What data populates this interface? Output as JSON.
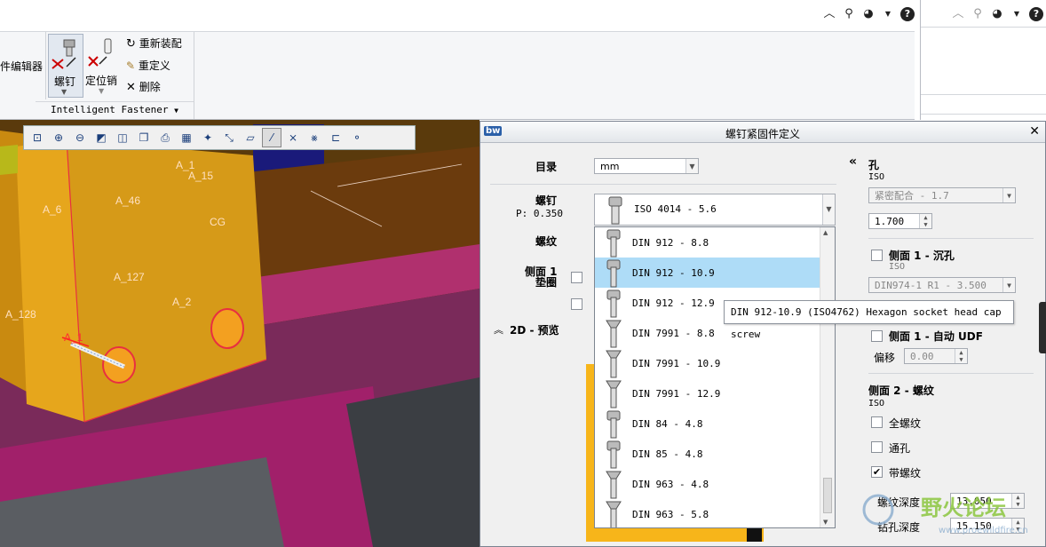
{
  "ribbon": {
    "partial_label": "件编辑器",
    "screw_label": "螺钉",
    "pin_label": "定位销",
    "reassemble_label": "重新装配",
    "redefine_label": "重定义",
    "delete_label": "删除",
    "group_label": "Intelligent Fastener"
  },
  "viewport": {
    "labels": [
      "A_6",
      "A_46",
      "A_127",
      "A_128",
      "A_2",
      "A_1",
      "CG",
      "A_1",
      "A_15"
    ]
  },
  "dialog": {
    "icon_text": "bw",
    "title": "螺钉紧固件定义",
    "catalog_label": "目录",
    "catalog_value": "mm",
    "screw_label": "螺钉",
    "screw_p": "P: 0.350",
    "screw_value": "ISO 4014 - 5.6",
    "thread_label": "螺纹",
    "side1_washer_label": "侧面 1",
    "side1_washer_label2": "垫圈",
    "preview_label": "2D - 预览",
    "collapse_glyph": "«",
    "hole_label": "孔",
    "hole_std": "ISO",
    "hole_fit": "紧密配合 - 1.7",
    "hole_size": "1.700",
    "side1_counter_label": "侧面 1 - 沉孔",
    "side1_counter_std": "ISO",
    "side1_counter_value": "DIN974-1 R1 - 3.500",
    "side1_udf_label": "侧面 1 - 自动 UDF",
    "offset_label": "偏移",
    "offset_value": "0.00",
    "side2_label": "侧面 2 - 螺纹",
    "side2_std": "ISO",
    "full_thread_label": "全螺纹",
    "through_label": "通孔",
    "threaded_label": "带螺纹",
    "thread_depth_label": "螺纹深度",
    "thread_depth_value": "13.050",
    "drill_depth_label": "钻孔深度",
    "drill_depth_value": "15.150"
  },
  "dropdown": {
    "options": [
      "DIN 912 - 8.8",
      "DIN 912 - 10.9",
      "DIN 912 - 12.9",
      "DIN 7991 - 8.8",
      "DIN 7991 - 10.9",
      "DIN 7991 - 12.9",
      "DIN 84 - 4.8",
      "DIN 85 - 4.8",
      "DIN 963 - 4.8",
      "DIN 963 - 5.8"
    ],
    "selected_index": 1
  },
  "tooltip": "DIN 912-10.9 (ISO4762) Hexagon socket head cap screw",
  "watermark": {
    "text": "野火论坛",
    "url": "www.proewildfire.cn"
  }
}
